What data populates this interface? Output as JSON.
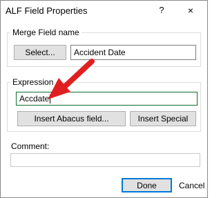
{
  "window": {
    "title": "ALF Field Properties",
    "help_label": "?",
    "close_label": "×"
  },
  "merge_group": {
    "label": "Merge Field name",
    "select_button": "Select...",
    "field_value": "Accident Date"
  },
  "expression_group": {
    "label": "Expression",
    "input_value": "Accdate",
    "insert_abacus_button": "Insert Abacus field...",
    "insert_special_button": "Insert Special"
  },
  "comment": {
    "label": "Comment:",
    "value": ""
  },
  "footer": {
    "done_label": "Done",
    "cancel_label": "Cancel"
  },
  "colors": {
    "arrow": "#e02020",
    "focus_border": "#0e6e2e",
    "default_button_border": "#0078d7"
  }
}
